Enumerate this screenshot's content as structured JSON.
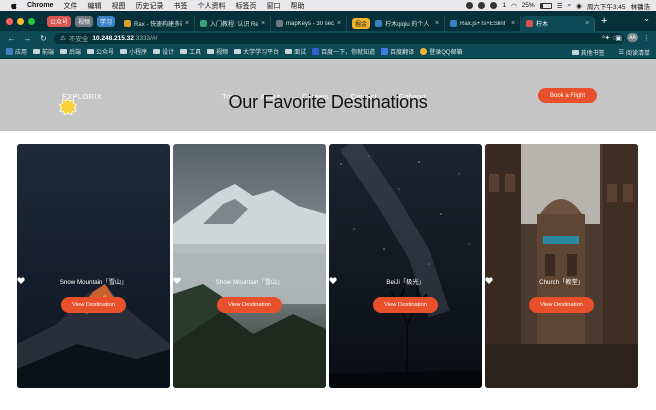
{
  "menubar": {
    "app": "Chrome",
    "items": [
      "文件",
      "编辑",
      "视图",
      "历史记录",
      "书签",
      "个人资料",
      "标签页",
      "窗口",
      "帮助"
    ],
    "notif_count": "1",
    "battery": "25%",
    "clock": "周六下午3:45",
    "user": "林镛浩"
  },
  "tabbar": {
    "chips": [
      {
        "label": "公众号",
        "color": "#d9534f"
      },
      {
        "label": "视频",
        "color": "#6c757d"
      },
      {
        "label": "学习",
        "color": "#3b82c4"
      }
    ],
    "tabs": [
      {
        "title": "Rax - 快速构建多端",
        "favicon": "#e0a030"
      },
      {
        "title": "入门教程: 认识 Re",
        "favicon": "#3aa17a"
      },
      {
        "title": "mapKeys - 30 sec",
        "favicon": "#6b7c80"
      },
      {
        "title": "柠木qiqiu 的个人",
        "favicon": "#3b82c4",
        "prefix_chip": "掘金",
        "prefix_color": "#f0b429"
      },
      {
        "title": "Rax.js+Ts+ESlint",
        "favicon": "#3b82c4"
      },
      {
        "title": "柠木",
        "favicon": "#d9534f",
        "active": true
      }
    ],
    "new_tab": "+"
  },
  "address": {
    "insecure_label": "不安全",
    "host": "10.248.215.32",
    "path": ":3333/#/"
  },
  "bookmarks": {
    "items": [
      "应用",
      "前端",
      "后端",
      "公众号",
      "小程序",
      "设计",
      "工具",
      "视频",
      "大学学习平台",
      "面试",
      "百度一下，你就知道",
      "百度翻译",
      "登录QQ邮箱"
    ],
    "right": [
      "其他书签",
      "阅读清单"
    ]
  },
  "site": {
    "logo": "EXPLORIX",
    "nav": [
      "Trips",
      "About",
      "Careers",
      "Contact",
      "Gobang"
    ],
    "title": "Our Favorite Destinations",
    "cta": "Book a Flight",
    "cards": [
      {
        "name": "Snow Mountain「雪山」",
        "button": "View Destination",
        "scene": "night-mountain"
      },
      {
        "name": "Snow Mountain「雪山」",
        "button": "View Destination",
        "scene": "misty-mountain"
      },
      {
        "name": "BeiJi「极光」",
        "button": "View Destination",
        "scene": "starry-tree"
      },
      {
        "name": "Church「教堂」",
        "button": "View Destination",
        "scene": "church"
      }
    ]
  },
  "colors": {
    "accent": "#e8502c",
    "browser_dark": "#06313a",
    "browser_toolbar": "#0d4a55",
    "hero_bg": "#c5c5c5"
  }
}
